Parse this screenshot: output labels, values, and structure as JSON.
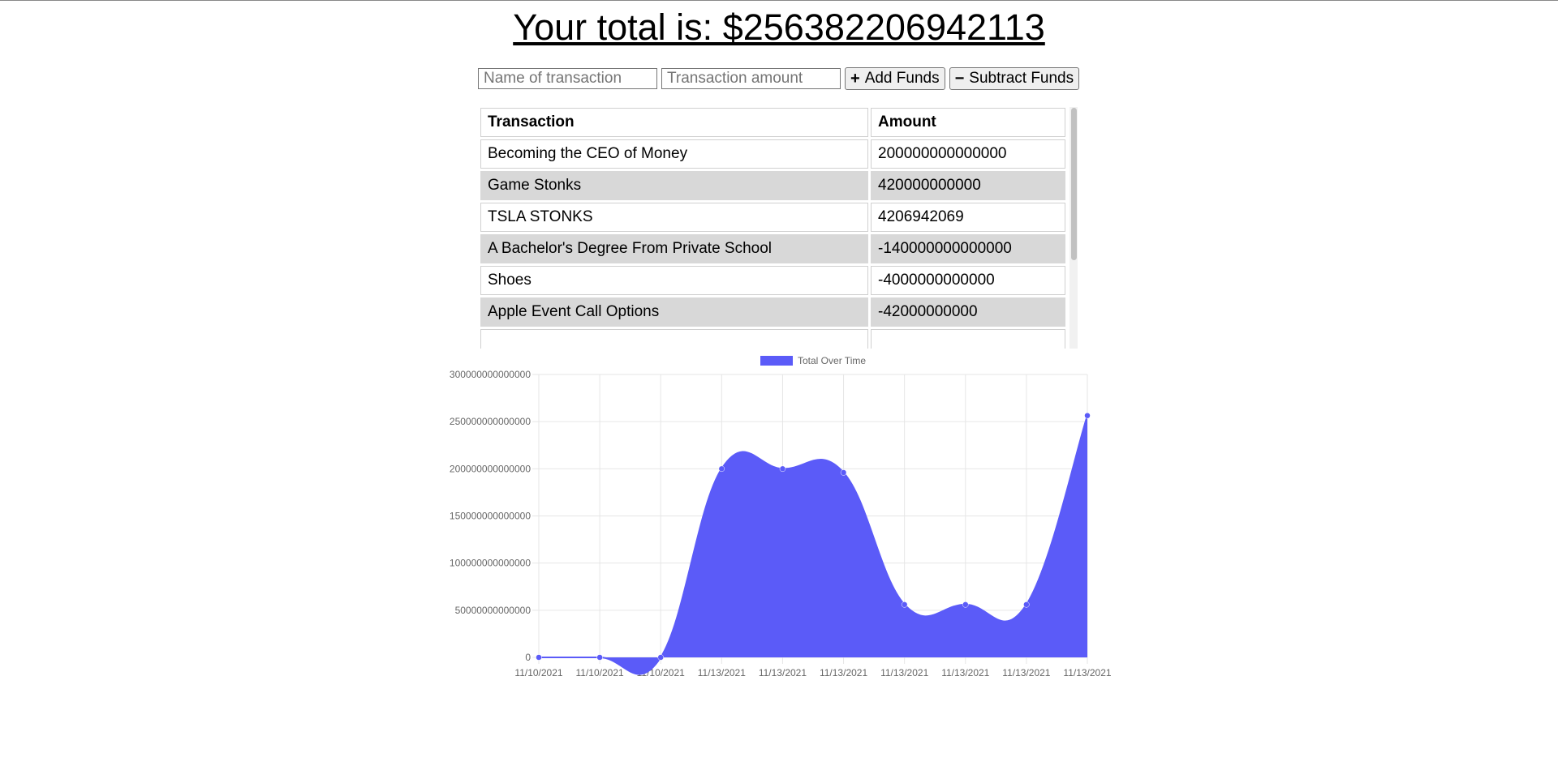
{
  "header": {
    "total_label": "Your total is: $256382206942113"
  },
  "form": {
    "name_placeholder": "Name of transaction",
    "amount_placeholder": "Transaction amount",
    "add_label": "Add Funds",
    "subtract_label": "Subtract Funds",
    "add_icon": "plus-icon",
    "subtract_icon": "minus-icon"
  },
  "table": {
    "headers": [
      "Transaction",
      "Amount"
    ],
    "rows": [
      {
        "name": "Becoming the CEO of Money",
        "amount": "200000000000000"
      },
      {
        "name": "Game Stonks",
        "amount": "420000000000"
      },
      {
        "name": "TSLA STONKS",
        "amount": "4206942069"
      },
      {
        "name": "A Bachelor's Degree From Private School",
        "amount": "-140000000000000"
      },
      {
        "name": "Shoes",
        "amount": "-4000000000000"
      },
      {
        "name": "Apple Event Call Options",
        "amount": "-42000000000"
      }
    ]
  },
  "colors": {
    "series_fill": "#5b5bf8",
    "series_line": "#5b5bf8",
    "grid": "#e6e6e6",
    "axis_text": "#666666"
  },
  "chart_data": {
    "type": "area",
    "legend": "top",
    "grid": true,
    "x": [
      "11/10/2021",
      "11/10/2021",
      "11/10/2021",
      "11/13/2021",
      "11/13/2021",
      "11/13/2021",
      "11/13/2021",
      "11/13/2021",
      "11/13/2021",
      "11/13/2021"
    ],
    "series": [
      {
        "name": "Total Over Time",
        "values": [
          0,
          0,
          0,
          200000000000000,
          200000000000000,
          196000000000000,
          56000000000000,
          56000000000000,
          56000000000000,
          256382206942113
        ]
      }
    ],
    "yticks": [
      "0",
      "50000000000000",
      "100000000000000",
      "150000000000000",
      "200000000000000",
      "250000000000000",
      "300000000000000"
    ],
    "ylim": [
      0,
      300000000000000
    ]
  }
}
